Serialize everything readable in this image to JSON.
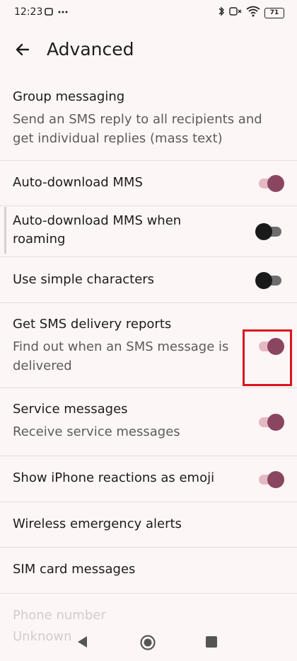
{
  "status": {
    "time": "12:23",
    "battery": "71"
  },
  "header": {
    "title": "Advanced"
  },
  "items": [
    {
      "title": "Group messaging",
      "subtitle": "Send an SMS reply to all recipients and get individual replies (mass text)"
    },
    {
      "title": "Auto-download MMS",
      "toggle": "on"
    },
    {
      "title": "Auto-download MMS when roaming",
      "toggle": "off"
    },
    {
      "title": "Use simple characters",
      "toggle": "off"
    },
    {
      "title": "Get SMS delivery reports",
      "subtitle": "Find out when an SMS message is delivered",
      "toggle": "on"
    },
    {
      "title": "Service messages",
      "subtitle": "Receive service messages",
      "toggle": "on"
    },
    {
      "title": "Show iPhone reactions as emoji",
      "toggle": "on"
    },
    {
      "title": "Wireless emergency alerts"
    },
    {
      "title": "SIM card messages"
    },
    {
      "title": "Phone number",
      "subtitle": "Unknown"
    }
  ],
  "colors": {
    "background": "#fdf6f6",
    "toggle_on_thumb": "#8a4660",
    "toggle_on_track": "#e6b8c4",
    "highlight": "#d9141e"
  },
  "icons": [
    "back-arrow-icon",
    "bluetooth-icon",
    "wifi-icon",
    "battery-icon",
    "nav-back-icon",
    "nav-home-icon",
    "nav-recents-icon"
  ]
}
